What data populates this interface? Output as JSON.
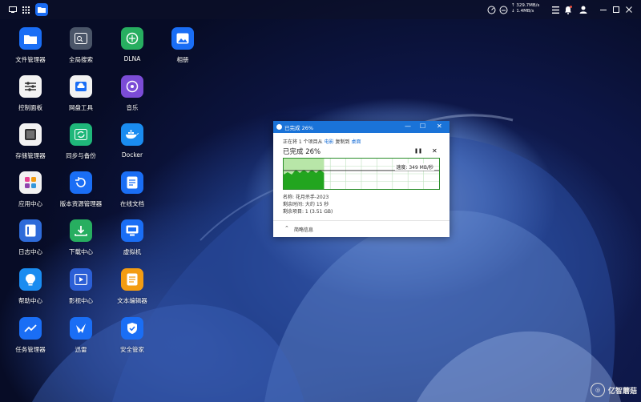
{
  "topbar": {
    "net_up": "329.7MB/s",
    "net_down": "1.4MB/s",
    "notification_badge": "1"
  },
  "desktop": {
    "icons": [
      {
        "label": "文件管理器",
        "icon": "folder-icon",
        "color": "#1a6ef5"
      },
      {
        "label": "全局搜索",
        "icon": "search-panel-icon",
        "color": "#4a5568"
      },
      {
        "label": "DLNA",
        "icon": "dlna-icon",
        "color": "#27ae60"
      },
      {
        "label": "相册",
        "icon": "photo-icon",
        "color": "#1a6ef5"
      },
      {
        "label": "控制面板",
        "icon": "sliders-icon",
        "color": "#f2f2f2"
      },
      {
        "label": "网盘工具",
        "icon": "cloud-drive-icon",
        "color": "#f2f2f2"
      },
      {
        "label": "音乐",
        "icon": "music-icon",
        "color": "#7b4cd6"
      },
      {
        "label": "存储管理器",
        "icon": "storage-icon",
        "color": "#f2f2f2"
      },
      {
        "label": "同步与备份",
        "icon": "sync-icon",
        "color": "#1fb77a"
      },
      {
        "label": "Docker",
        "icon": "docker-icon",
        "color": "#1a8cf0"
      },
      {
        "label": "应用中心",
        "icon": "app-center-icon",
        "color": "#f2f2f2"
      },
      {
        "label": "版本资源管理器",
        "icon": "version-icon",
        "color": "#1a6ef5"
      },
      {
        "label": "在线文档",
        "icon": "document-icon",
        "color": "#1a6ef5"
      },
      {
        "label": "日志中心",
        "icon": "log-icon",
        "color": "#2e6bd9"
      },
      {
        "label": "下载中心",
        "icon": "download-icon",
        "color": "#27ae60"
      },
      {
        "label": "虚拟机",
        "icon": "vm-icon",
        "color": "#1a6ef5"
      },
      {
        "label": "帮助中心",
        "icon": "help-icon",
        "color": "#1a8cf0"
      },
      {
        "label": "影视中心",
        "icon": "video-icon",
        "color": "#2b5fd6"
      },
      {
        "label": "文本编辑器",
        "icon": "text-editor-icon",
        "color": "#f39c12"
      },
      {
        "label": "任务管理器",
        "icon": "task-manager-icon",
        "color": "#1a6ef5"
      },
      {
        "label": "迅雷",
        "icon": "thunder-icon",
        "color": "#1a6ef5"
      },
      {
        "label": "安全管家",
        "icon": "shield-icon",
        "color": "#1a6ef5"
      }
    ]
  },
  "dialog": {
    "title": "已完成 26%",
    "line_prefix": "正在将 1 个项目从",
    "source": "电影",
    "mid": "复制到",
    "dest": "桌面",
    "percent_label": "已完成 26%",
    "progress": 0.26,
    "speed": "速度: 349 MB/秒",
    "name": "名称: 花月杀手-2023",
    "remaining_time": "剩余时间: 大约 15 秒",
    "remaining_items": "剩余项目: 1 (3.51 GB)",
    "footer": "简略信息"
  },
  "watermark": {
    "text": "亿智蘑菇"
  }
}
